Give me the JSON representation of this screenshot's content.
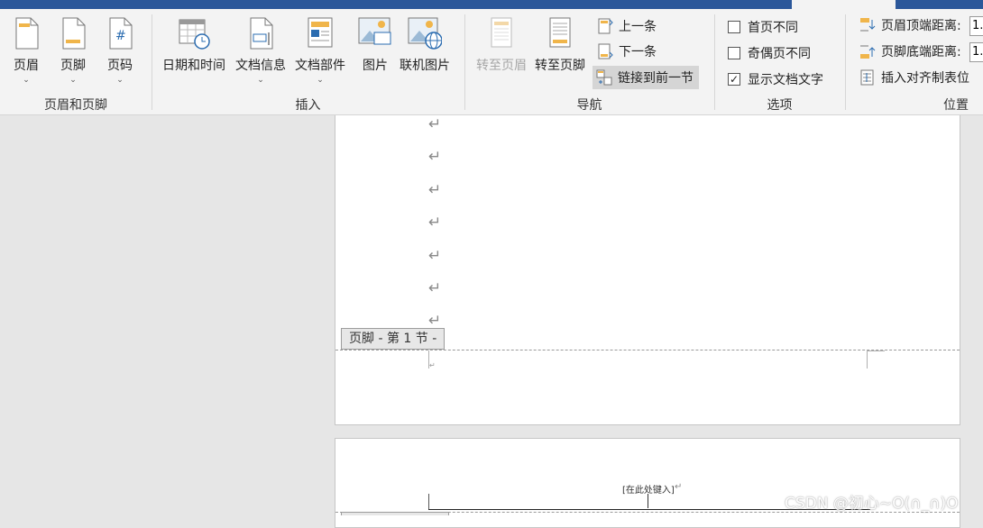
{
  "ribbon": {
    "groups": {
      "header_footer": "页眉和页脚",
      "insert": "插入",
      "navigation": "导航",
      "options": "选项",
      "position": "位置"
    },
    "header_footer": {
      "header": "页眉",
      "footer": "页脚",
      "page_number": "页码"
    },
    "insert": {
      "date_time": "日期和时间",
      "doc_info": "文档信息",
      "doc_parts": "文档部件",
      "picture": "图片",
      "online_picture": "联机图片"
    },
    "navigation": {
      "go_to_header": "转至页眉",
      "go_to_footer": "转至页脚",
      "previous": "上一条",
      "next": "下一条",
      "link_to_previous": "链接到前一节"
    },
    "options": {
      "different_first": "首页不同",
      "different_odd_even": "奇偶页不同",
      "show_doc_text": "显示文档文字",
      "different_first_checked": false,
      "different_odd_even_checked": false,
      "show_doc_text_checked": true
    },
    "position": {
      "header_top": "页眉顶端距离:",
      "footer_bottom": "页脚底端距离:",
      "insert_align_tab": "插入对齐制表位",
      "header_top_value": "1.",
      "footer_bottom_value": "1."
    }
  },
  "document": {
    "paragraph_mark": "↵",
    "footer_label": "页脚 - 第 1 节 -",
    "placeholder": "[在此处键入]",
    "placeholder_mark": "↵",
    "small_mark": "↵"
  },
  "watermark": "CSDN @初心~O(∩_∩)O",
  "colors": {
    "title_bar": "#2b579a",
    "ribbon_bg": "#f3f3f3",
    "canvas_bg": "#e6e6e6",
    "active_button": "#d5d5d5"
  }
}
